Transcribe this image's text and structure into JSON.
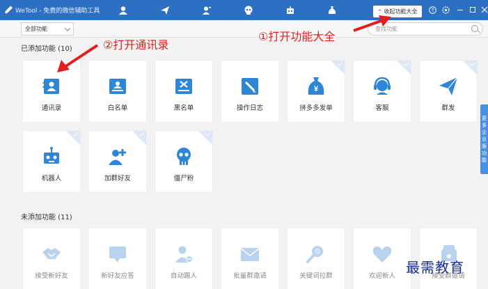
{
  "window": {
    "title": "WeTool - 免费的微信辅助工具",
    "collapse_button": "收起功能大全",
    "nav_icons": [
      "user-icon",
      "send-icon",
      "contacts-icon",
      "skull-icon",
      "robot-icon",
      "money-bag-icon"
    ],
    "controls": [
      "help-icon",
      "settings-icon",
      "minimize-icon",
      "maximize-icon",
      "close-icon"
    ]
  },
  "toolbar": {
    "filter_value": "全部功能",
    "search_placeholder": "查找功能"
  },
  "added_section": {
    "title": "已添加功能 (10)",
    "items": [
      {
        "label": "通讯录",
        "icon": "contact-card-icon"
      },
      {
        "label": "白名单",
        "icon": "whitelist-icon"
      },
      {
        "label": "黑名单",
        "icon": "blacklist-icon"
      },
      {
        "label": "操作日志",
        "icon": "log-pencil-icon"
      },
      {
        "label": "拼多多发单",
        "icon": "money-bag-icon"
      },
      {
        "label": "客服",
        "icon": "headset-icon"
      },
      {
        "label": "群发",
        "icon": "paper-plane-icon"
      },
      {
        "label": "机器人",
        "icon": "robot-icon"
      },
      {
        "label": "加群好友",
        "icon": "add-friend-icon"
      },
      {
        "label": "僵尸粉",
        "icon": "skull-icon"
      }
    ]
  },
  "unadded_section": {
    "title": "未添加功能 (11)",
    "items": [
      {
        "label": "接受新好友",
        "icon": "handshake-icon"
      },
      {
        "label": "新好友应答",
        "icon": "chat-bubble-icon"
      },
      {
        "label": "自动踢人",
        "icon": "kick-user-icon"
      },
      {
        "label": "批量群邀请",
        "icon": "envelope-icon"
      },
      {
        "label": "关键词拉群",
        "icon": "magnifier-icon"
      },
      {
        "label": "欢迎新人",
        "icon": "heart-icon"
      },
      {
        "label": "接受群邀请",
        "icon": "group-invite-icon"
      }
    ]
  },
  "side_tab": {
    "text": "更多企业版功能"
  },
  "annotations": {
    "step1": "①打开功能大全",
    "step2": "②打开通讯录"
  },
  "watermark": "最需教育",
  "colors": {
    "brand_blue": "#2d6fc2",
    "icon_blue": "#2f86d6",
    "disabled_icon": "#b9d3ee",
    "annotation_red": "#e02020"
  }
}
